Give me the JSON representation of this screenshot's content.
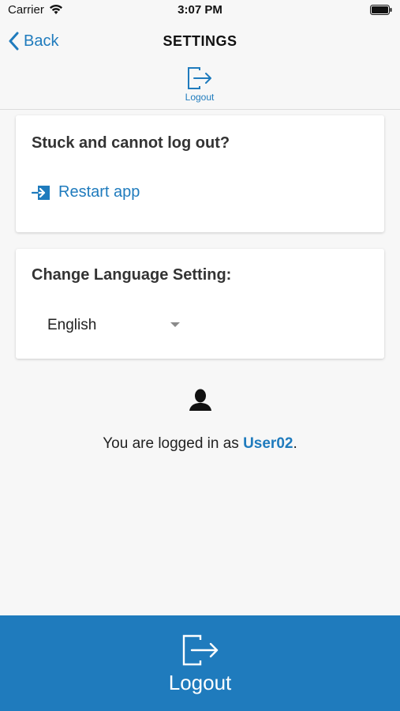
{
  "status_bar": {
    "carrier": "Carrier",
    "time": "3:07 PM"
  },
  "nav": {
    "back_label": "Back",
    "title": "SETTINGS",
    "logout_label": "Logout"
  },
  "restart_card": {
    "title": "Stuck and cannot log out?",
    "link_label": "Restart app"
  },
  "language_card": {
    "title": "Change Language Setting:",
    "selected": "English"
  },
  "user_info": {
    "prefix": "You are logged in as ",
    "username": "User02",
    "suffix": "."
  },
  "bottom_bar": {
    "logout_label": "Logout"
  },
  "colors": {
    "accent": "#1f7bbd",
    "background": "#f7f7f7"
  }
}
